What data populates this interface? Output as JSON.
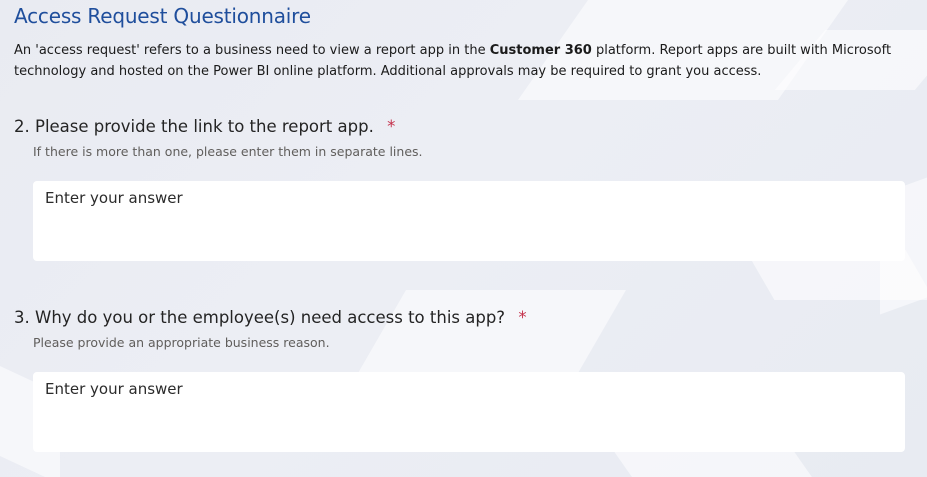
{
  "section": {
    "title": "Access Request Questionnaire",
    "intro_before": "An 'access request' refers to a business need to view a report app in the ",
    "intro_bold": "Customer 360",
    "intro_after": " platform. Report apps are built with Microsoft technology and hosted on the Power BI online platform. Additional approvals may be required to grant you access."
  },
  "questions": [
    {
      "number": "2.",
      "title": "Please provide the link to the report app.",
      "required_mark": "*",
      "subtitle": "If there is more than one, please enter them in separate lines.",
      "placeholder": "Enter your answer",
      "value": ""
    },
    {
      "number": "3.",
      "title": "Why do you or the employee(s) need access to this app?",
      "required_mark": "*",
      "subtitle": "Please provide an appropriate business reason.",
      "placeholder": "Enter your answer",
      "value": ""
    }
  ],
  "colors": {
    "title": "#1f4e9c",
    "required": "#c4314b",
    "background": "#ebedf3"
  }
}
